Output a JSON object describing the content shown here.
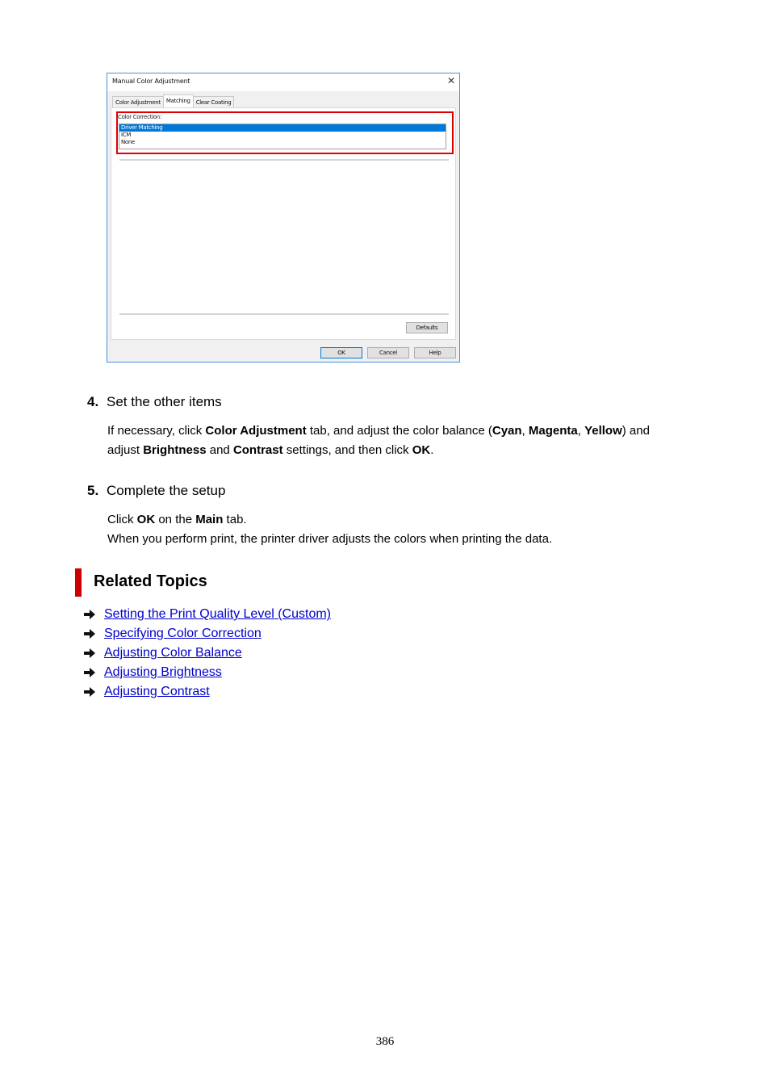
{
  "dialog": {
    "title": "Manual Color Adjustment",
    "close_icon": "close-icon",
    "tabs": [
      {
        "label": "Color Adjustment",
        "active": false
      },
      {
        "label": "Matching",
        "active": true
      },
      {
        "label": "Clear Coating",
        "active": false
      }
    ],
    "color_correction": {
      "label": "Color Correction:",
      "options": [
        "Driver Matching",
        "ICM",
        "None"
      ],
      "selected": "Driver Matching"
    },
    "buttons": {
      "defaults": "Defaults",
      "ok": "OK",
      "cancel": "Cancel",
      "help": "Help"
    },
    "highlight_color": "#e00000",
    "selection_color": "#0078d7"
  },
  "steps": [
    {
      "number": "4.",
      "title": "Set the other items",
      "lines": [
        [
          {
            "t": "If necessary, click ",
            "b": false
          },
          {
            "t": "Color Adjustment",
            "b": true
          },
          {
            "t": " tab, and adjust the color balance (",
            "b": false
          },
          {
            "t": "Cyan",
            "b": true
          },
          {
            "t": ", ",
            "b": false
          },
          {
            "t": "Magenta",
            "b": true
          },
          {
            "t": ", ",
            "b": false
          },
          {
            "t": "Yellow",
            "b": true
          },
          {
            "t": ") and",
            "b": false
          }
        ],
        [
          {
            "t": "adjust ",
            "b": false
          },
          {
            "t": "Brightness",
            "b": true
          },
          {
            "t": " and ",
            "b": false
          },
          {
            "t": "Contrast",
            "b": true
          },
          {
            "t": " settings, and then click ",
            "b": false
          },
          {
            "t": "OK",
            "b": true
          },
          {
            "t": ".",
            "b": false
          }
        ]
      ]
    },
    {
      "number": "5.",
      "title": "Complete the setup",
      "lines": [
        [
          {
            "t": "Click ",
            "b": false
          },
          {
            "t": "OK",
            "b": true
          },
          {
            "t": " on the ",
            "b": false
          },
          {
            "t": "Main",
            "b": true
          },
          {
            "t": " tab.",
            "b": false
          }
        ],
        [
          {
            "t": "When you perform print, the printer driver adjusts the colors when printing the data.",
            "b": false
          }
        ]
      ]
    }
  ],
  "related_topics": {
    "title": "Related Topics",
    "accent_color": "#cc0000",
    "link_color": "#0000cc",
    "links": [
      "Setting the Print Quality Level (Custom)",
      "Specifying Color Correction",
      "Adjusting Color Balance",
      "Adjusting Brightness",
      "Adjusting Contrast"
    ]
  },
  "page_number": "386"
}
